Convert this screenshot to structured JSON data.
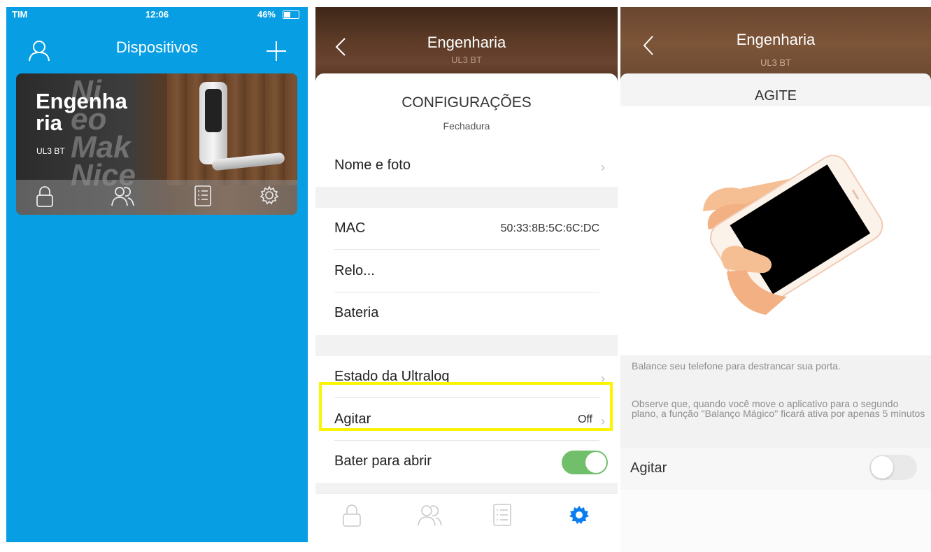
{
  "panel1": {
    "status": {
      "carrier": "TIM",
      "time": "12:06",
      "battery": "46%"
    },
    "header": {
      "title": "Dispositivos"
    },
    "device": {
      "name": "Engenharia",
      "model": "UL3 BT",
      "name_line1": "Engenha",
      "name_line2": "ria"
    },
    "card_icons": [
      "lock-icon",
      "users-icon",
      "list-icon",
      "gear-icon"
    ]
  },
  "panel2": {
    "header": {
      "title": "Engenharia",
      "subtitle": "UL3 BT"
    },
    "section_title": "CONFIGURAÇÕES",
    "section_subtitle": "Fechadura",
    "rows": {
      "nome_foto": "Nome e foto",
      "mac": "MAC",
      "mac_value": "50:33:8B:5C:6C:DC",
      "relogio": "Relo...",
      "bateria": "Bateria",
      "estado": "Estado da Ultraloq",
      "agitar": "Agitar",
      "agitar_value": "Off",
      "bater": "Bater para abrir"
    },
    "bater_toggle_on": true,
    "tabs": [
      "lock-icon",
      "users-icon",
      "list-icon",
      "gear-icon"
    ],
    "active_tab": "gear-icon",
    "accent_color": "#0a7ef0",
    "highlight_color": "#fcf400"
  },
  "panel3": {
    "header": {
      "title": "Engenharia",
      "subtitle": "UL3 BT"
    },
    "section_title": "AGITE",
    "text1": "Balance seu telefone para destrancar sua porta.",
    "text2": "Observe que, quando você move o aplicativo para o segundo plano, a função \"Balanço Mágico\" ficará ativa por apenas 5 minutos",
    "toggle_label": "Agitar",
    "toggle_on": false
  }
}
